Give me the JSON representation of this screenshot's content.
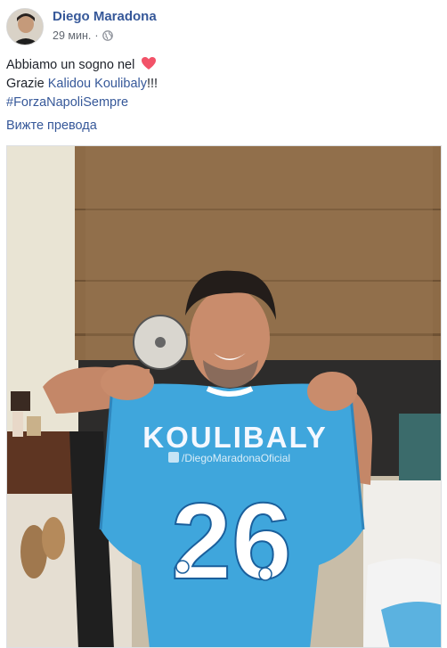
{
  "post": {
    "author": "Diego Maradona",
    "time": "29 мин.",
    "separator": "·",
    "privacy_icon": "globe-icon",
    "text_line1": "Abbiamo un sogno nel",
    "heart_icon": "heart-icon",
    "text_line2_prefix": "Grazie",
    "mention": "Kalidou Koulibaly",
    "text_line2_suffix": "!!!",
    "hashtag": "#ForzaNapoliSempre",
    "translate_link": "Вижте превода"
  },
  "photo": {
    "jersey_name": "KOULIBALY",
    "jersey_number": "26",
    "watermark": "/DiegoMaradonaOficial"
  },
  "colors": {
    "link": "#365899",
    "jersey": "#3fa6dc",
    "heart": "#f25268"
  }
}
